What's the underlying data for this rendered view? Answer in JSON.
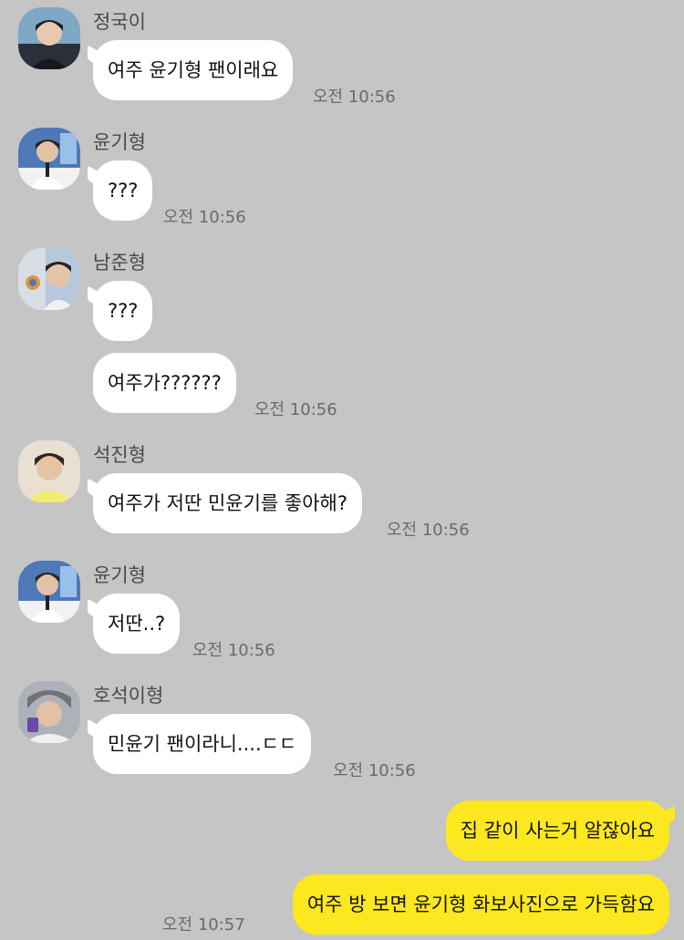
{
  "messages": [
    {
      "sender": "정국이",
      "avatar": "jungkook-avatar",
      "lines": [
        "여주 윤기형 팬이래요"
      ],
      "time": "오전 10:56"
    },
    {
      "sender": "윤기형",
      "avatar": "yoongi-avatar",
      "lines": [
        "???"
      ],
      "time": "오전 10:56"
    },
    {
      "sender": "남준형",
      "avatar": "namjoon-avatar",
      "lines": [
        "???",
        "여주가??????"
      ],
      "time": "오전 10:56"
    },
    {
      "sender": "석진형",
      "avatar": "seokjin-avatar",
      "lines": [
        "여주가 저딴 민윤기를 좋아해?"
      ],
      "time": "오전 10:56"
    },
    {
      "sender": "윤기형",
      "avatar": "yoongi-avatar",
      "lines": [
        "저딴..?"
      ],
      "time": "오전 10:56"
    },
    {
      "sender": "호석이형",
      "avatar": "hoseok-avatar",
      "lines": [
        "민윤기 팬이라니....ㄷㄷ"
      ],
      "time": "오전 10:56"
    }
  ],
  "my_messages": {
    "lines": [
      "집 같이 사는거 알잖아요",
      "여주 방 보면 윤기형 화보사진으로 가득함요"
    ],
    "time": "오전 10:57"
  },
  "colors": {
    "background": "#c5c5c5",
    "incoming_bubble": "#ffffff",
    "outgoing_bubble": "#fde81f"
  }
}
